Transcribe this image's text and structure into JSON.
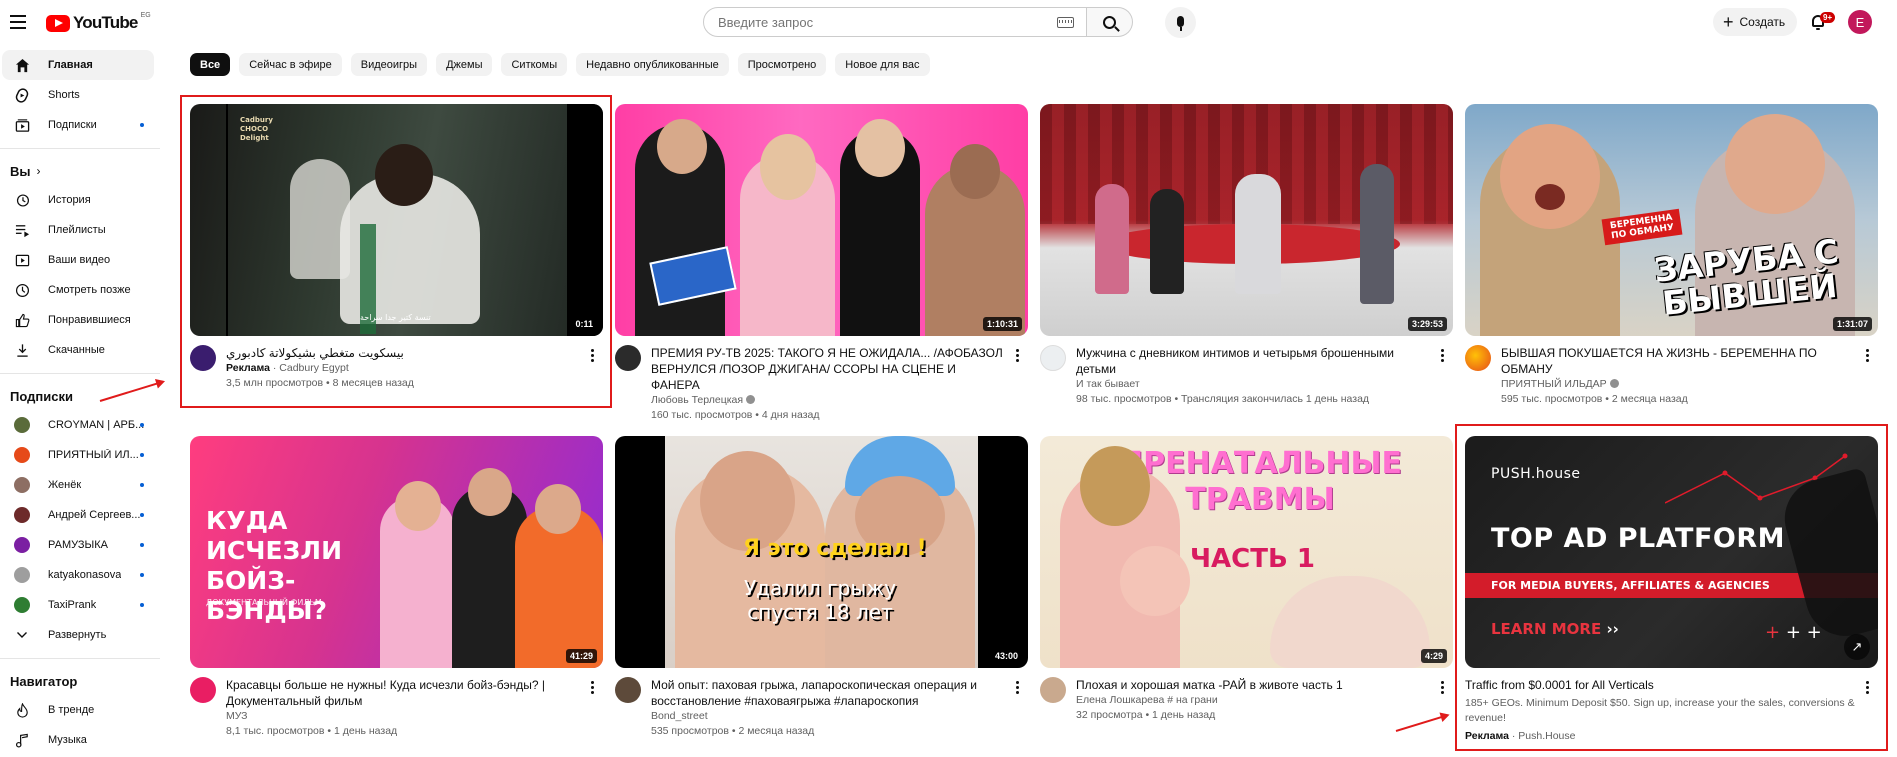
{
  "brand": {
    "name": "YouTube",
    "country": "EG",
    "accent": "#ff0000"
  },
  "search": {
    "placeholder": "Введите запрос"
  },
  "header": {
    "create_label": "Создать",
    "notif_count": "9+",
    "avatar_letter": "E"
  },
  "sidebar": {
    "main": [
      {
        "label": "Главная",
        "icon": "home-icon",
        "active": true
      },
      {
        "label": "Shorts",
        "icon": "shorts-icon"
      },
      {
        "label": "Подписки",
        "icon": "subscriptions-icon",
        "dot": true
      }
    ],
    "you_heading": "Вы",
    "you": [
      {
        "label": "История",
        "icon": "history-icon"
      },
      {
        "label": "Плейлисты",
        "icon": "playlists-icon"
      },
      {
        "label": "Ваши видео",
        "icon": "your-videos-icon"
      },
      {
        "label": "Смотреть позже",
        "icon": "watch-later-icon"
      },
      {
        "label": "Понравившиеся",
        "icon": "like-icon"
      },
      {
        "label": "Скачанные",
        "icon": "download-icon"
      }
    ],
    "subs_heading": "Подписки",
    "subs": [
      {
        "label": "CROYMAN | АРБ...",
        "color": "#5a6b3a"
      },
      {
        "label": "ПРИЯТНЫЙ ИЛ...",
        "color": "#e64a19"
      },
      {
        "label": "Женёк",
        "color": "#8d6e63"
      },
      {
        "label": "Андрей Сергеев...",
        "color": "#6d2a2a"
      },
      {
        "label": "РАМУЗЫКА",
        "color": "#7b1fa2"
      },
      {
        "label": "katyakonasova",
        "color": "#9e9e9e"
      },
      {
        "label": "TaxiPrank",
        "color": "#2e7d32"
      }
    ],
    "expand_label": "Развернуть",
    "nav_heading": "Навигатор",
    "nav": [
      {
        "label": "В тренде",
        "icon": "trending-icon"
      },
      {
        "label": "Музыка",
        "icon": "music-icon"
      }
    ]
  },
  "chips": [
    "Все",
    "Сейчас в эфире",
    "Видеоигры",
    "Джемы",
    "Ситкомы",
    "Недавно опубликованные",
    "Просмотрено",
    "Новое для вас"
  ],
  "videos": [
    {
      "title": "بيسكويت متغطي بشيكولاتة كادبوري",
      "line1": "Реклама",
      "line1b": " · Cadbury Egypt",
      "line2": "3,5 млн просмотров • 8 месяцев назад",
      "duration": "0:11",
      "ad": true,
      "thumb_text": "Cadbury CHOCO Delight"
    },
    {
      "title": "ПРЕМИЯ РУ-ТВ 2025: ТАКОГО Я НЕ ОЖИДАЛА... /АФОБАЗОЛ ВЕРНУЛСЯ /ПОЗОР ДЖИГАНА/ ССОРЫ НА СЦЕНЕ И ФАНЕРА",
      "line1": "Любовь Терлецкая",
      "line2": "160 тыс. просмотров • 4 дня назад",
      "duration": "1:10:31",
      "verified": true
    },
    {
      "title": "Мужчина с дневником интимов и четырьмя брошенными детьми",
      "line1": "И так бывает",
      "line2": "98 тыс. просмотров • Трансляция закончилась 1 день назад",
      "duration": "3:29:53"
    },
    {
      "title": "БЫВШАЯ ПОКУШАЕТСЯ НА ЖИЗНЬ - БЕРЕМЕННА ПО ОБМАНУ",
      "line1": "ПРИЯТНЫЙ ИЛЬДАР",
      "line2": "595 тыс. просмотров • 2 месяца назад",
      "duration": "1:31:07",
      "verified": true,
      "thumb_text": "ЗАРУБА С БЫВШЕЙ",
      "thumb_badge": "БЕРЕМЕННА ПО ОБМАНУ"
    },
    {
      "title": "Красавцы больше не нужны! Куда исчезли бойз-бэнды? | Документальный фильм",
      "line1": "МУЗ",
      "line2": "8,1 тыс. просмотров • 1 день назад",
      "duration": "41:29",
      "thumb_text": "КУДА ИСЧЕЗЛИ БОЙЗ-БЭНДЫ?",
      "thumb_sub": "ДОКУМЕНТАЛЬНЫЙ ФИЛЬМ"
    },
    {
      "title": "Мой опыт: паховая грыжа, лапароскопическая операция и восстановление #паховаягрыжа #лапароскопия",
      "line1": "Bond_street",
      "line2": "535 просмотров • 2 месяца назад",
      "duration": "43:00",
      "thumb_text": "Я это сделал !",
      "thumb_sub": "Удалил грыжу спустя 18 лет"
    },
    {
      "title": "Плохая и хорошая матка -РАЙ в животе часть 1",
      "line1": "Елена Лошкарева # на грани",
      "line2": "32 просмотра • 1 день назад",
      "duration": "4:29",
      "thumb_text": "ПРЕНАТАЛЬНЫЕ ТРАВМЫ",
      "thumb_sub": "ЧАСТЬ 1"
    },
    {
      "title": "Traffic from $0.0001 for All Verticals",
      "line1": "185+ GEOs. Minimum Deposit $50. Sign up, increase your the sales, conversions & revenue!",
      "line2a": "Реклама",
      "line2b": " · Push.House",
      "ad": true,
      "thumb_brand": "PUSH.house",
      "thumb_text": "TOP AD PLATFORM",
      "thumb_sub": "FOR MEDIA BUYERS, AFFILIATES & AGENCIES",
      "thumb_cta": "LEARN MORE"
    }
  ]
}
